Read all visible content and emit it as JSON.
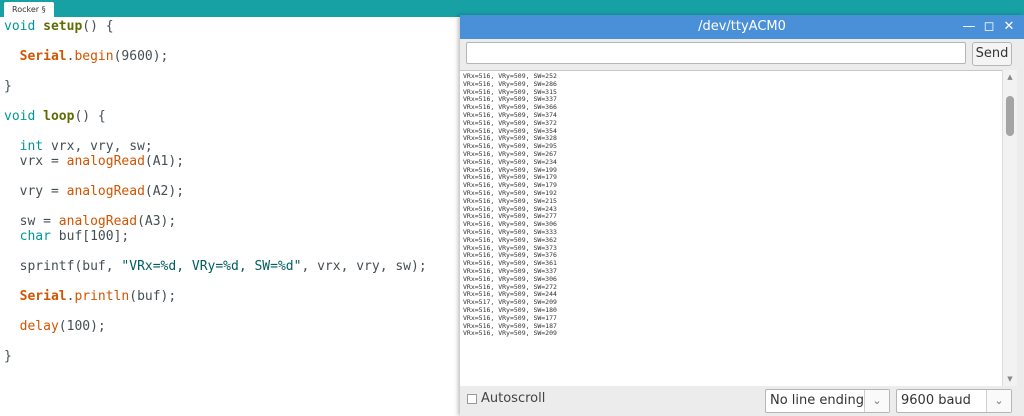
{
  "ide": {
    "tab_label": "Rocker §"
  },
  "editor": {
    "lines": [
      {
        "parts": [
          {
            "t": "void ",
            "c": "kw-type"
          },
          {
            "t": "setup",
            "c": "kw-setup"
          },
          {
            "t": "() {",
            "c": ""
          }
        ]
      },
      {
        "parts": []
      },
      {
        "parts": [
          {
            "t": "  ",
            "c": ""
          },
          {
            "t": "Serial",
            "c": "kw-lib"
          },
          {
            "t": ".",
            "c": ""
          },
          {
            "t": "begin",
            "c": "kw-call"
          },
          {
            "t": "(9600);",
            "c": ""
          }
        ]
      },
      {
        "parts": []
      },
      {
        "parts": [
          {
            "t": "}",
            "c": ""
          }
        ]
      },
      {
        "parts": []
      },
      {
        "parts": [
          {
            "t": "void ",
            "c": "kw-type"
          },
          {
            "t": "loop",
            "c": "kw-setup"
          },
          {
            "t": "() {",
            "c": ""
          }
        ]
      },
      {
        "parts": []
      },
      {
        "parts": [
          {
            "t": "  ",
            "c": ""
          },
          {
            "t": "int",
            "c": "kw-type"
          },
          {
            "t": " vrx, vry, sw;",
            "c": ""
          }
        ]
      },
      {
        "parts": [
          {
            "t": "  vrx = ",
            "c": ""
          },
          {
            "t": "analogRead",
            "c": "kw-call"
          },
          {
            "t": "(A1);",
            "c": ""
          }
        ]
      },
      {
        "parts": []
      },
      {
        "parts": [
          {
            "t": "  vry = ",
            "c": ""
          },
          {
            "t": "analogRead",
            "c": "kw-call"
          },
          {
            "t": "(A2);",
            "c": ""
          }
        ]
      },
      {
        "parts": []
      },
      {
        "parts": [
          {
            "t": "  sw = ",
            "c": ""
          },
          {
            "t": "analogRead",
            "c": "kw-call"
          },
          {
            "t": "(A3);",
            "c": ""
          }
        ]
      },
      {
        "parts": [
          {
            "t": "  ",
            "c": ""
          },
          {
            "t": "char",
            "c": "kw-type"
          },
          {
            "t": " buf[100];",
            "c": ""
          }
        ]
      },
      {
        "parts": []
      },
      {
        "parts": [
          {
            "t": "  ",
            "c": ""
          },
          {
            "t": "sprintf",
            "c": ""
          },
          {
            "t": "(buf, ",
            "c": ""
          },
          {
            "t": "\"VRx=%d, VRy=%d, SW=%d\"",
            "c": "kw-str"
          },
          {
            "t": ", vrx, vry, sw);",
            "c": ""
          }
        ]
      },
      {
        "parts": []
      },
      {
        "parts": [
          {
            "t": "  ",
            "c": ""
          },
          {
            "t": "Serial",
            "c": "kw-lib"
          },
          {
            "t": ".",
            "c": ""
          },
          {
            "t": "println",
            "c": "kw-call"
          },
          {
            "t": "(buf);",
            "c": ""
          }
        ]
      },
      {
        "parts": []
      },
      {
        "parts": [
          {
            "t": "  ",
            "c": ""
          },
          {
            "t": "delay",
            "c": "kw-call"
          },
          {
            "t": "(100);",
            "c": ""
          }
        ]
      },
      {
        "parts": []
      },
      {
        "parts": [
          {
            "t": "}",
            "c": ""
          }
        ]
      }
    ]
  },
  "serial_monitor": {
    "title": "/dev/ttyACM0",
    "minimize_icon": "minimize-icon",
    "maximize_icon": "maximize-icon",
    "close_icon": "close-icon",
    "input_value": "",
    "send_label": "Send",
    "output_lines": [
      "VRx=516, VRy=509, SW=252",
      "VRx=516, VRy=509, SW=286",
      "VRx=516, VRy=509, SW=315",
      "VRx=516, VRy=509, SW=337",
      "VRx=516, VRy=509, SW=366",
      "VRx=516, VRy=509, SW=374",
      "VRx=516, VRy=509, SW=372",
      "VRx=516, VRy=509, SW=354",
      "VRx=516, VRy=509, SW=328",
      "VRx=516, VRy=509, SW=295",
      "VRx=516, VRy=509, SW=267",
      "VRx=516, VRy=509, SW=234",
      "VRx=516, VRy=509, SW=199",
      "VRx=516, VRy=509, SW=179",
      "VRx=516, VRy=509, SW=179",
      "VRx=516, VRy=509, SW=192",
      "VRx=516, VRy=509, SW=215",
      "VRx=516, VRy=509, SW=243",
      "VRx=516, VRy=509, SW=277",
      "VRx=516, VRy=509, SW=306",
      "VRx=516, VRy=509, SW=333",
      "VRx=516, VRy=509, SW=362",
      "VRx=516, VRy=509, SW=373",
      "VRx=516, VRy=509, SW=376",
      "VRx=516, VRy=509, SW=361",
      "VRx=516, VRy=509, SW=337",
      "VRx=516, VRy=509, SW=306",
      "VRx=516, VRy=509, SW=272",
      "VRx=516, VRy=509, SW=244",
      "VRx=517, VRy=509, SW=209",
      "VRx=516, VRy=509, SW=180",
      "VRx=516, VRy=509, SW=177",
      "VRx=516, VRy=509, SW=187",
      "VRx=516, VRy=509, SW=209"
    ],
    "autoscroll_label": "Autoscroll",
    "autoscroll_checked": false,
    "line_ending_value": "No line ending",
    "baud_value": "9600 baud"
  },
  "colors": {
    "tab_strip": "#17a1a5",
    "titlebar": "#4a90d9"
  }
}
